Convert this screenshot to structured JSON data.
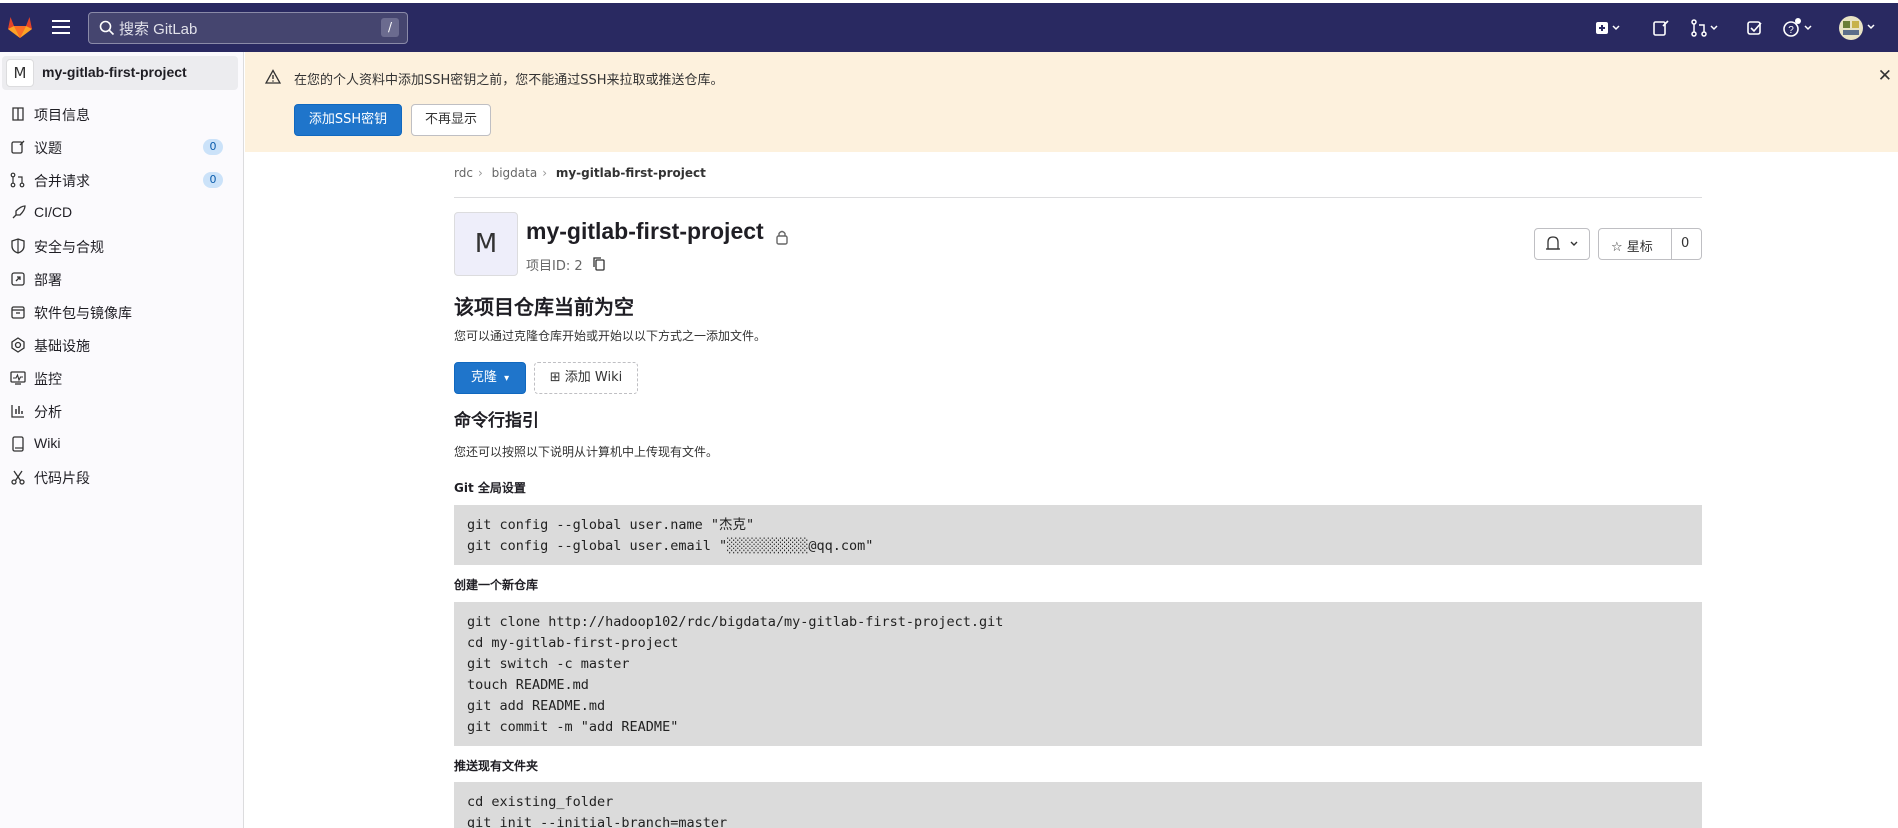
{
  "topbar": {
    "search_placeholder": "搜索 GitLab",
    "search_shortcut": "/"
  },
  "sidebar": {
    "project_avatar": "M",
    "project_name": "my-gitlab-first-project",
    "items": [
      {
        "label": "项目信息",
        "icon": "project-info-icon"
      },
      {
        "label": "议题",
        "icon": "issues-icon",
        "badge": "0"
      },
      {
        "label": "合并请求",
        "icon": "merge-request-icon",
        "badge": "0"
      },
      {
        "label": "CI/CD",
        "icon": "rocket-icon"
      },
      {
        "label": "安全与合规",
        "icon": "shield-icon"
      },
      {
        "label": "部署",
        "icon": "deploy-icon"
      },
      {
        "label": "软件包与镜像库",
        "icon": "package-icon"
      },
      {
        "label": "基础设施",
        "icon": "cloud-gear-icon"
      },
      {
        "label": "监控",
        "icon": "monitor-icon"
      },
      {
        "label": "分析",
        "icon": "chart-icon"
      },
      {
        "label": "Wiki",
        "icon": "book-icon"
      },
      {
        "label": "代码片段",
        "icon": "scissors-icon"
      }
    ]
  },
  "banner": {
    "message": "在您的个人资料中添加SSH密钥之前，您不能通过SSH来拉取或推送仓库。",
    "add_key_label": "添加SSH密钥",
    "dismiss_label": "不再显示"
  },
  "breadcrumb": [
    "rdc",
    "bigdata",
    "my-gitlab-first-project"
  ],
  "project": {
    "avatar": "M",
    "title": "my-gitlab-first-project",
    "id_text": "项目ID: 2",
    "star_label": "星标",
    "star_count": "0"
  },
  "empty": {
    "heading": "该项目仓库当前为空",
    "description": "您可以通过克隆仓库开始或开始以以下方式之一添加文件。",
    "clone_label": "克隆",
    "add_wiki_label": "添加 Wiki"
  },
  "cmd": {
    "heading": "命令行指引",
    "description": "您还可以按照以下说明从计算机中上传现有文件。",
    "sections": [
      {
        "title": "Git 全局设置",
        "lines": [
          "git config --global user.name \"杰克\"",
          "git config --global user.email \"░░░░░░░░░░@qq.com\""
        ]
      },
      {
        "title": "创建一个新仓库",
        "lines": [
          "git clone http://hadoop102/rdc/bigdata/my-gitlab-first-project.git",
          "cd my-gitlab-first-project",
          "git switch -c master",
          "touch README.md",
          "git add README.md",
          "git commit -m \"add README\""
        ]
      },
      {
        "title": "推送现有文件夹",
        "lines": [
          "cd existing_folder",
          "git init --initial-branch=master"
        ]
      }
    ]
  },
  "colors": {
    "topbar": "#292961",
    "banner": "#fdf1dd",
    "primary": "#1f75cb"
  }
}
